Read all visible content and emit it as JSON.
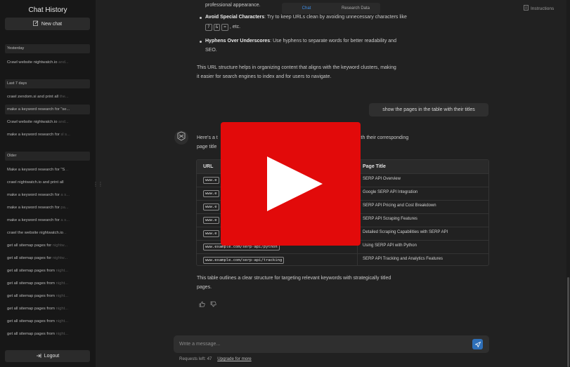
{
  "sidebar": {
    "title": "Chat History",
    "new_chat": "New chat",
    "sections": [
      {
        "label": "Yesterday"
      },
      {
        "label": "Last 7 days"
      },
      {
        "label": "Older"
      }
    ],
    "yesterday": [
      {
        "text": "Crawl website nightwatch.io",
        "fade": " and..."
      }
    ],
    "last7": [
      {
        "text": "crawl zendom.si and print all",
        "fade": " the..."
      },
      {
        "text": "make a keyword research for \"se...",
        "fade": ""
      },
      {
        "text": "Crawl website nightwatch.io",
        "fade": " and..."
      },
      {
        "text": "make a keyword research for",
        "fade": " sl s..."
      }
    ],
    "older": [
      {
        "text": "Make a keyword research for \"S",
        "fade": "..."
      },
      {
        "text": "crawl nightwatch.io and print all",
        "fade": ""
      },
      {
        "text": "make a keyword research for",
        "fade": " a s..."
      },
      {
        "text": "make a keyword research for",
        "fade": " pa..."
      },
      {
        "text": "make a keyword research for",
        "fade": " a s..."
      },
      {
        "text": "crawl the website nightwatch.io",
        "fade": "..."
      },
      {
        "text": "get all sitemap pages for",
        "fade": " nightw..."
      },
      {
        "text": "get all sitemap pages for",
        "fade": " nightw..."
      },
      {
        "text": "get all sitemap pages from",
        "fade": " night..."
      },
      {
        "text": "get all sitemap pages from",
        "fade": " night..."
      },
      {
        "text": "get all sitemap pages from",
        "fade": " night..."
      },
      {
        "text": "get all sitemap pages from",
        "fade": " night..."
      },
      {
        "text": "get all sitemap pages from",
        "fade": " night..."
      },
      {
        "text": "get all sitemap pages from",
        "fade": " night..."
      },
      {
        "text": "get all sitemap pages from",
        "fade": " night..."
      }
    ],
    "logout": "Logout"
  },
  "tabs": {
    "chat": "Chat",
    "research": "Research Data"
  },
  "instructions": "Instructions",
  "content": {
    "line_top": "professional appearance.",
    "b2_title": "Avoid Special Characters",
    "b2_text": ": Try to keep URLs clean by avoiding unnecessary characters like",
    "b2_chars": [
      "?",
      "&",
      "="
    ],
    "b2_tail": ", etc.",
    "b3_title": "Hyphens Over Underscores",
    "b3_text": ": Use hyphens to separate words for better readability and",
    "b3_line2": "SEO.",
    "para1_l1": "This URL structure helps in organizing content that aligns with the keyword clusters, making",
    "para1_l2": "it easier for search engines to index and for users to navigate.",
    "user_msg": "show the pages in the table with their titles",
    "reply_l1a": "Here's a t",
    "reply_l1b": "ith their corresponding",
    "reply_l2": "page title",
    "table": {
      "headers": [
        "URL",
        "Page Title"
      ],
      "rows": [
        {
          "url": "www.e",
          "title": "SERP API Overview"
        },
        {
          "url": "www.e",
          "title": "Google SERP API Integration"
        },
        {
          "url": "www.e",
          "title": "SERP API Pricing and Cost Breakdown"
        },
        {
          "url": "www.e",
          "title": "SERP API Scraping Features"
        },
        {
          "url": "www.e",
          "title": "Detailed Scraping Capabilities with SERP API"
        },
        {
          "url": "www.example.com/serp-api/python",
          "title": "Using SERP API with Python"
        },
        {
          "url": "www.example.com/serp-api/tracking",
          "title": "SERP API Tracking and Analytics Features"
        }
      ]
    },
    "closing_l1": "This table outlines a clear structure for targeting relevant keywords with strategically titled",
    "closing_l2": "pages."
  },
  "composer": {
    "placeholder": "Write a message...",
    "requests_label": "Requests left:",
    "requests_count": "47",
    "upgrade": "Upgrade for more"
  },
  "colors": {
    "accent": "#3e8ee8",
    "play_red": "#e20a0a",
    "send": "#2e6fb8"
  }
}
